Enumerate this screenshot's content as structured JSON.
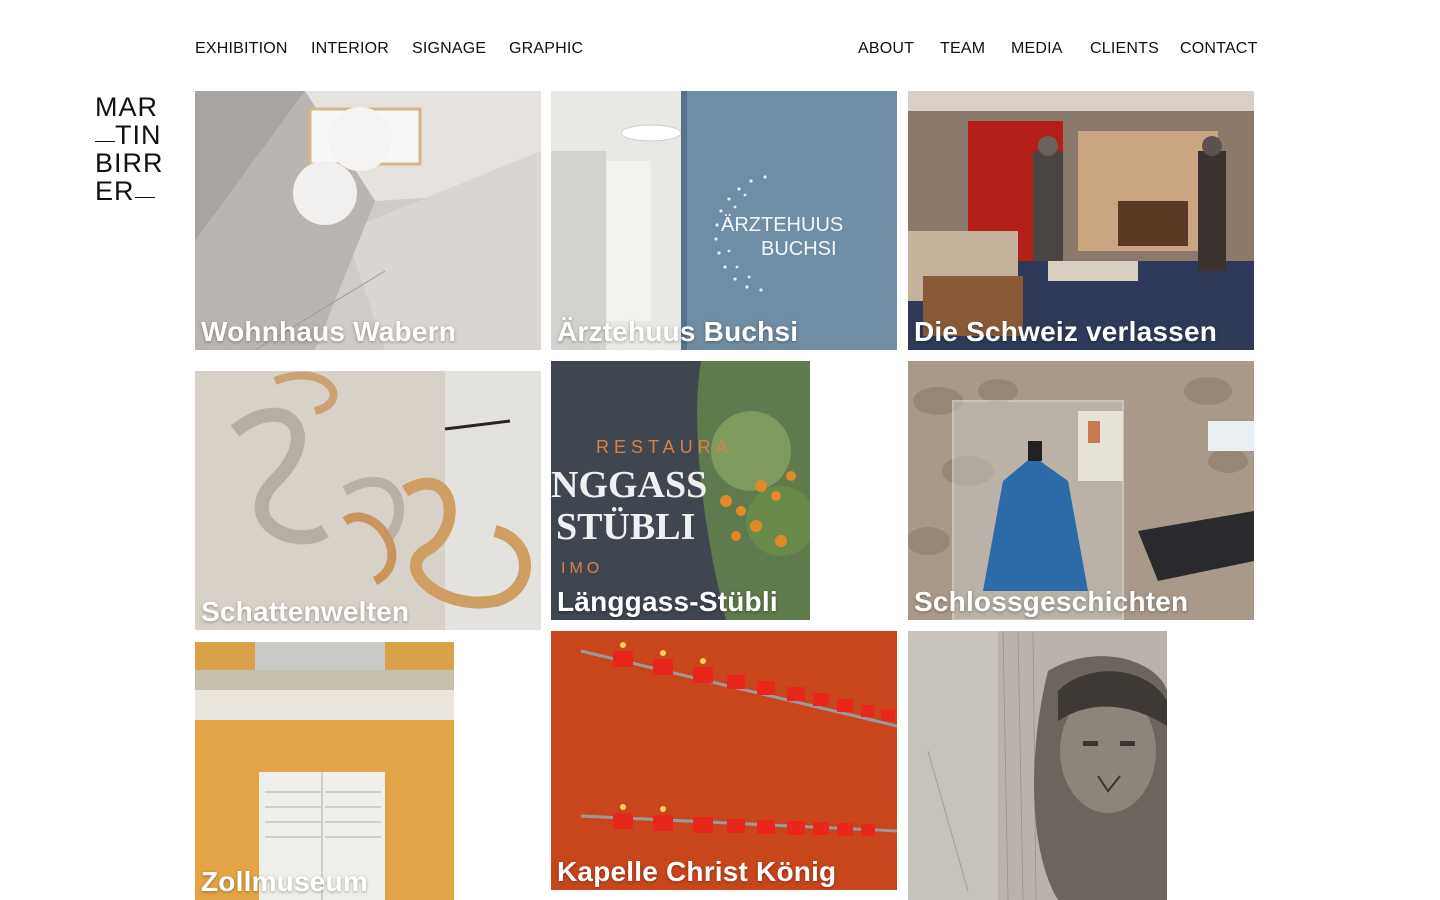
{
  "nav": {
    "left": [
      "EXHIBITION",
      "INTERIOR",
      "SIGNAGE",
      "GRAPHIC"
    ],
    "right": [
      "ABOUT",
      "TEAM",
      "MEDIA",
      "CLIENTS",
      "CONTACT"
    ]
  },
  "logo": {
    "lines": [
      "MAR",
      "TIN",
      "BIRR",
      "ER"
    ]
  },
  "projects": [
    {
      "title": "Wohnhaus Wabern"
    },
    {
      "title": "Ärztehuus Buchsi",
      "sign_line1": "ÄRZTEHUUS",
      "sign_line2": "BUCHSI"
    },
    {
      "title": "Die Schweiz verlassen"
    },
    {
      "title": "Schattenwelten"
    },
    {
      "title": "Länggass-Stübli",
      "text_top": "RESTAURA",
      "text_mid": "NGGASS",
      "text_bot": "STÜBLI",
      "text_small": "IMO"
    },
    {
      "title": "Schlossgeschichten"
    },
    {
      "title": "Zollmuseum"
    },
    {
      "title": "Kapelle Christ König"
    },
    {
      "title": ""
    }
  ]
}
